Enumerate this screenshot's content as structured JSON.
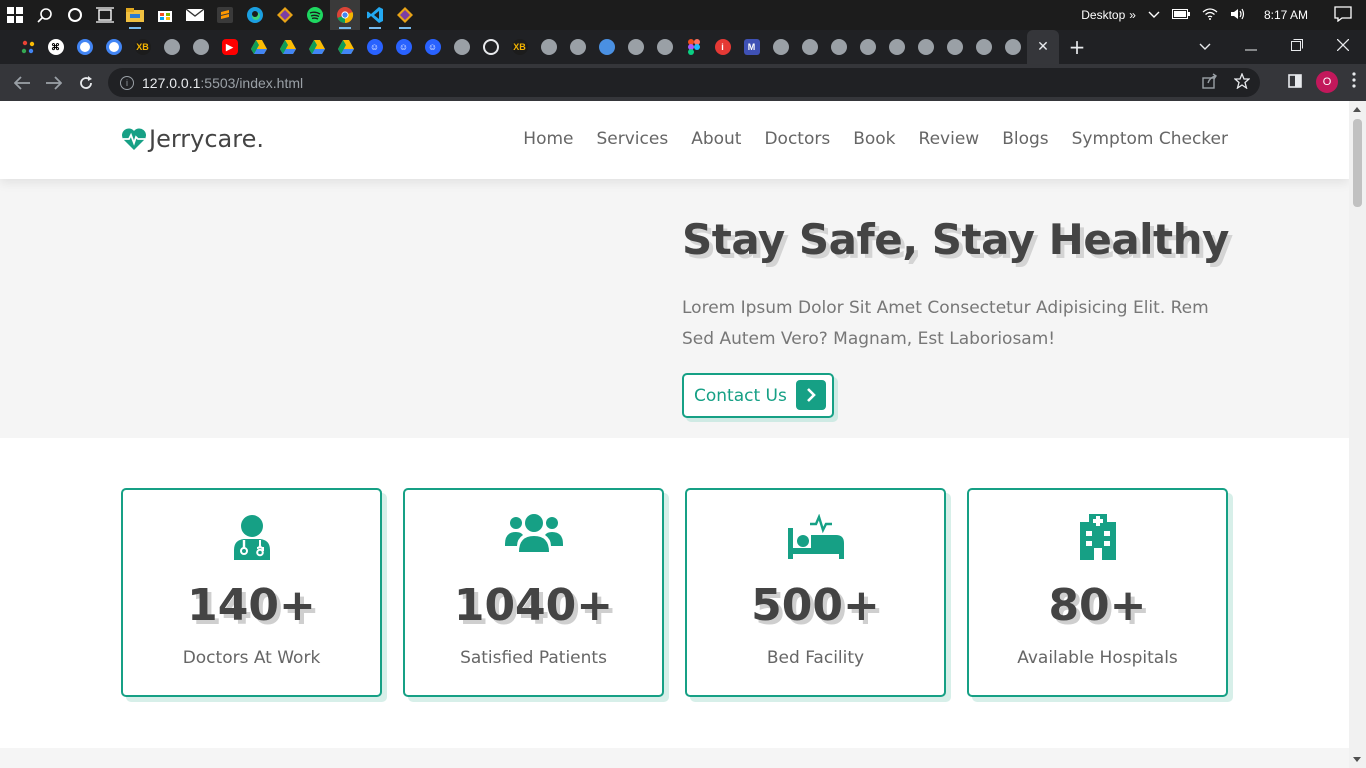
{
  "taskbar": {
    "desktop_label": "Desktop",
    "time": "8:17 AM",
    "chevron": "»"
  },
  "browser": {
    "url_host": "127.0.0.1",
    "url_path": ":5503/index.html",
    "profile_initial": "O",
    "active_tab_close": "✕",
    "new_tab": "+"
  },
  "site": {
    "logo_text": "Jerrycare.",
    "nav": [
      "Home",
      "Services",
      "About",
      "Doctors",
      "Book",
      "Review",
      "Blogs",
      "Symptom Checker"
    ],
    "hero": {
      "title": "Stay Safe, Stay Healthy",
      "text": "Lorem Ipsum Dolor Sit Amet Consectetur Adipisicing Elit. Rem Sed Autem Vero? Magnam, Est Laboriosam!",
      "button_label": "Contact Us"
    },
    "stats": [
      {
        "icon": "doctor-icon",
        "value": "140+",
        "label": "Doctors At Work"
      },
      {
        "icon": "patients-icon",
        "value": "1040+",
        "label": "Satisfied Patients"
      },
      {
        "icon": "bed-icon",
        "value": "500+",
        "label": "Bed Facility"
      },
      {
        "icon": "hospital-icon",
        "value": "80+",
        "label": "Available Hospitals"
      }
    ]
  },
  "colors": {
    "accent": "#16a085",
    "text_dark": "#444444",
    "text_muted": "#666666",
    "hero_bg": "#f5f5f5"
  }
}
